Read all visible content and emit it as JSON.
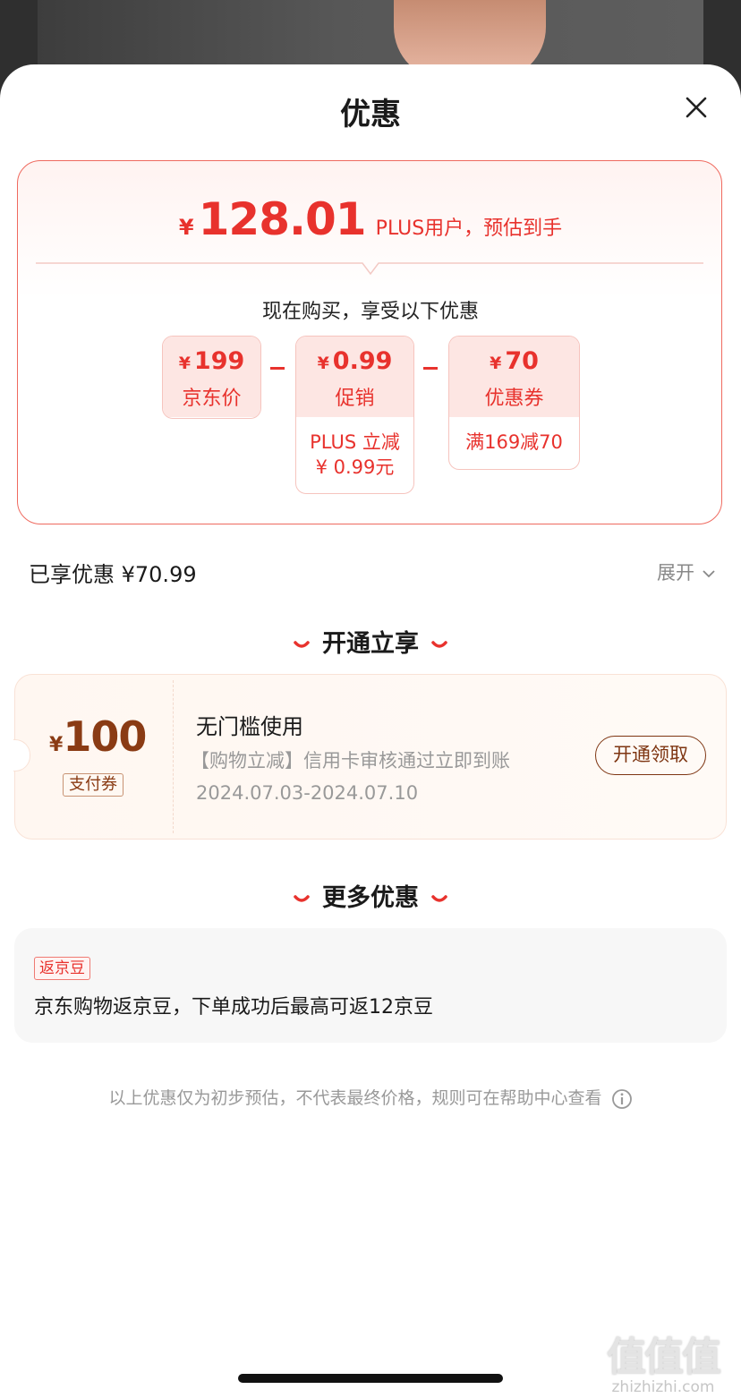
{
  "sheet": {
    "title": "优惠"
  },
  "summary": {
    "currency": "¥",
    "final_price": "128.01",
    "final_note": "PLUS用户，预估到手",
    "buy_title": "现在购买，享受以下优惠",
    "boxes": [
      {
        "currency": "¥",
        "value": "199",
        "label": "京东价"
      },
      {
        "currency": "¥",
        "value": "0.99",
        "label": "促销",
        "detail_line1": "PLUS 立减",
        "detail_line2": "¥ 0.99元"
      },
      {
        "currency": "¥",
        "value": "70",
        "label": "优惠券",
        "detail_line1": "满169减70"
      }
    ]
  },
  "enjoyed": {
    "text": "已享优惠 ¥70.99",
    "expand_label": "展开"
  },
  "open_section": {
    "title": "开通立享",
    "coupon": {
      "currency": "¥",
      "amount": "100",
      "tag": "支付券",
      "title": "无门槛使用",
      "desc": "【购物立减】信用卡审核通过立即到账",
      "date": "2024.07.03-2024.07.10",
      "button": "开通领取"
    }
  },
  "more_section": {
    "title": "更多优惠",
    "bean": {
      "tag": "返京豆",
      "text": "京东购物返京豆，下单成功后最高可返12京豆"
    }
  },
  "disclaimer": "以上优惠仅为初步预估，不代表最终价格，规则可在帮助中心查看",
  "watermark": {
    "big": "值值值",
    "small": "zhizhizhi.com"
  },
  "colors": {
    "accent": "#e8322d",
    "coupon_brown": "#8a3b14"
  }
}
